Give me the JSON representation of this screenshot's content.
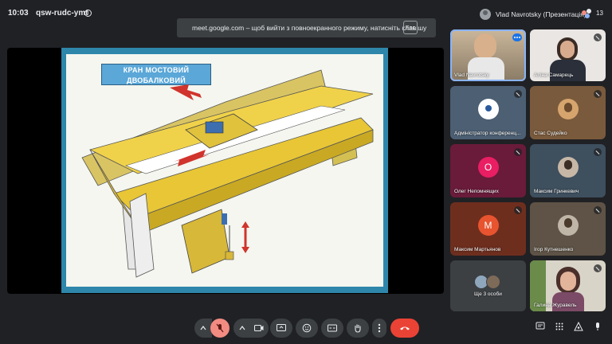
{
  "header": {
    "time": "10:03",
    "meeting_code": "qsw-rudc-ymt",
    "presenter": "Vlad Navrotsky (Презентація)",
    "participant_count": "13"
  },
  "banner": {
    "text": "meet.google.com – щоб вийти з повноекранного режиму, натисніть клавішу",
    "key": "Esc"
  },
  "slide": {
    "title_line1": "КРАН МОСТОВИЙ",
    "title_line2": "ДВОБАЛКОВИЙ"
  },
  "participants": [
    {
      "name": "Vlad Navrotsky",
      "state": "speaking"
    },
    {
      "name": "Аліна Самарець",
      "state": "muted"
    },
    {
      "name": "Адміністратор конференц...",
      "state": "muted"
    },
    {
      "name": "Стас Судейко",
      "state": "muted"
    },
    {
      "name": "Олег Непомнящих",
      "state": "muted",
      "letter": "О"
    },
    {
      "name": "Максим Гринкевич",
      "state": "muted"
    },
    {
      "name": "Максим Мартьянов",
      "state": "muted",
      "letter": "M"
    },
    {
      "name": "Ігор Кутнешенко",
      "state": "muted"
    },
    {
      "name": "Ще 3 особи",
      "state": ""
    },
    {
      "name": "Галина Журавель",
      "state": "muted"
    }
  ],
  "colors": {
    "accent": "#1a73e8",
    "leave": "#ea4335",
    "mic_off": "#f28b82",
    "slide_frame": "#2e86ab"
  }
}
